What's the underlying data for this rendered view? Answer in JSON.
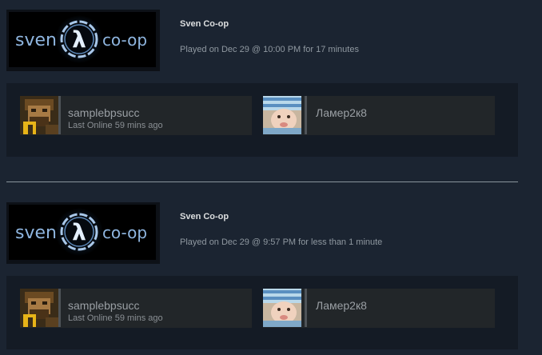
{
  "sessions": [
    {
      "game": {
        "logo_text_left": "sven",
        "logo_symbol": "λ",
        "logo_text_right": "co-op",
        "title": "Sven Co-op",
        "played": "Played on Dec 29 @ 10:00 PM for 17 minutes"
      },
      "friends": [
        {
          "name": "samplebpsucc",
          "status": "Last Online 59 mins ago"
        },
        {
          "name": "Ламер2к8",
          "status": ""
        }
      ]
    },
    {
      "game": {
        "logo_text_left": "sven",
        "logo_symbol": "λ",
        "logo_text_right": "co-op",
        "title": "Sven Co-op",
        "played": "Played on Dec 29 @ 9:57 PM for less than 1 minute"
      },
      "friends": [
        {
          "name": "samplebpsucc",
          "status": "Last Online 59 mins ago"
        },
        {
          "name": "Ламер2к8",
          "status": ""
        }
      ]
    }
  ],
  "colors": {
    "background": "#1b2431",
    "panel": "#141b25",
    "friend_card": "#222629",
    "logo_blue": "#8fb6e0"
  },
  "icons": {
    "avatar_1": "bearded-soldier-avatar-icon",
    "avatar_2": "baby-striped-hat-avatar-icon",
    "logo": "sven-coop-lambda-logo-icon"
  }
}
